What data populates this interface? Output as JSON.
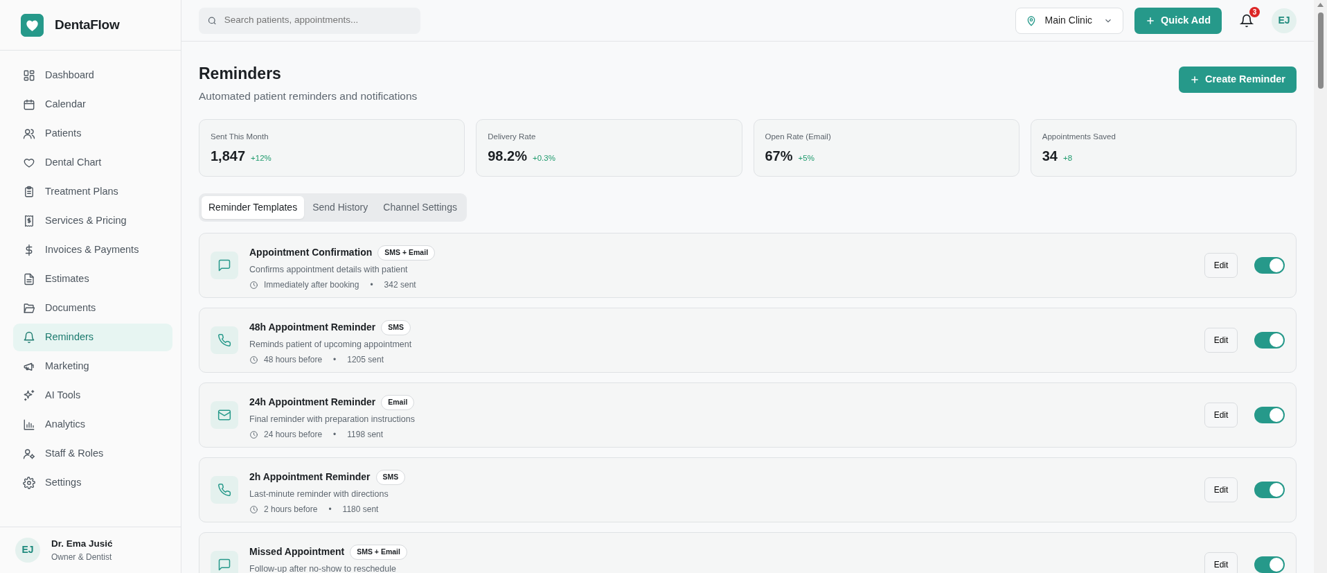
{
  "brand": {
    "name": "DentaFlow"
  },
  "sidebar": {
    "items": [
      {
        "label": "Dashboard",
        "selected": false
      },
      {
        "label": "Calendar",
        "selected": false
      },
      {
        "label": "Patients",
        "selected": false
      },
      {
        "label": "Dental Chart",
        "selected": false
      },
      {
        "label": "Treatment Plans",
        "selected": false
      },
      {
        "label": "Services & Pricing",
        "selected": false
      },
      {
        "label": "Invoices & Payments",
        "selected": false
      },
      {
        "label": "Estimates",
        "selected": false
      },
      {
        "label": "Documents",
        "selected": false
      },
      {
        "label": "Reminders",
        "selected": true
      },
      {
        "label": "Marketing",
        "selected": false
      },
      {
        "label": "AI Tools",
        "selected": false
      },
      {
        "label": "Analytics",
        "selected": false
      },
      {
        "label": "Staff & Roles",
        "selected": false
      },
      {
        "label": "Settings",
        "selected": false
      }
    ],
    "user": {
      "initials": "EJ",
      "name": "Dr. Ema Jusić",
      "role": "Owner & Dentist"
    }
  },
  "topbar": {
    "search": {
      "placeholder": "Search patients, appointments..."
    },
    "clinic": "Main Clinic",
    "quick_add": "Quick Add",
    "notifications": "3",
    "avatar": "EJ"
  },
  "page": {
    "title": "Reminders",
    "subtitle": "Automated patient reminders and notifications",
    "create_button": "Create Reminder"
  },
  "stats": [
    {
      "label": "Sent This Month",
      "value": "1,847",
      "change": "+12%"
    },
    {
      "label": "Delivery Rate",
      "value": "98.2%",
      "change": "+0.3%"
    },
    {
      "label": "Open Rate (Email)",
      "value": "67%",
      "change": "+5%"
    },
    {
      "label": "Appointments Saved",
      "value": "34",
      "change": "+8"
    }
  ],
  "tabs": [
    {
      "label": "Reminder Templates",
      "selected": true
    },
    {
      "label": "Send History",
      "selected": false
    },
    {
      "label": "Channel Settings",
      "selected": false
    }
  ],
  "templates": [
    {
      "kind": "chat",
      "title": "Appointment Confirmation",
      "channel": "SMS + Email",
      "description": "Confirms appointment details with patient",
      "timing": "Immediately after booking",
      "separator": "•",
      "sent": "342 sent",
      "edit": "Edit",
      "on": true
    },
    {
      "kind": "phone",
      "title": "48h Appointment Reminder",
      "channel": "SMS",
      "description": "Reminds patient of upcoming appointment",
      "timing": "48 hours before",
      "separator": "•",
      "sent": "1205 sent",
      "edit": "Edit",
      "on": true
    },
    {
      "kind": "mail",
      "title": "24h Appointment Reminder",
      "channel": "Email",
      "description": "Final reminder with preparation instructions",
      "timing": "24 hours before",
      "separator": "•",
      "sent": "1198 sent",
      "edit": "Edit",
      "on": true
    },
    {
      "kind": "phone",
      "title": "2h Appointment Reminder",
      "channel": "SMS",
      "description": "Last-minute reminder with directions",
      "timing": "2 hours before",
      "separator": "•",
      "sent": "1180 sent",
      "edit": "Edit",
      "on": true
    },
    {
      "kind": "chat",
      "title": "Missed Appointment",
      "channel": "SMS + Email",
      "description": "Follow-up after no-show to reschedule",
      "edit": "Edit",
      "on": true
    }
  ]
}
